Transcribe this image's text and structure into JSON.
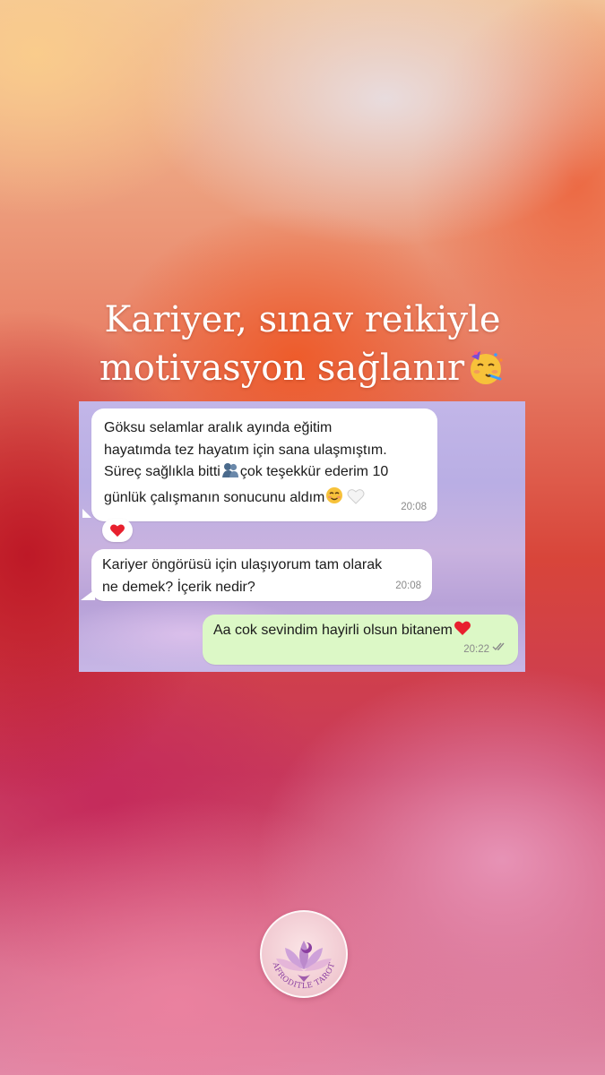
{
  "headline": {
    "line1": "Kariyer, sınav reikiyle",
    "line2": "motivasyon sağlanır",
    "emoji": "partying-face-icon"
  },
  "chat": {
    "messages": [
      {
        "direction": "incoming",
        "lines": [
          "Göksu selamlar aralık ayında eğitim",
          "hayatımda tez hayatım için sana ulaşmıştım.",
          "Süreç sağlıkla bitti",
          "çok teşekkür ederim 10",
          "günlük çalışmanın sonucunu aldım"
        ],
        "time": "20:08",
        "emojis": [
          "people-hugging-icon",
          "smiling-face-icon",
          "white-heart-icon"
        ],
        "reaction": "red-heart-icon"
      },
      {
        "direction": "incoming",
        "lines": [
          "Kariyer öngörüsü için ulaşıyorum tam olarak",
          "ne demek? İçerik nedir?"
        ],
        "time": "20:08"
      },
      {
        "direction": "outgoing",
        "lines": [
          "Aa cok sevindim hayirli olsun bitanem"
        ],
        "time": "20:22",
        "emojis": [
          "red-heart-icon"
        ],
        "status": "read-double-check-icon"
      }
    ]
  },
  "logo": {
    "text": "AFRODITLE TAROT",
    "icon": "lotus-moon-icon"
  },
  "colors": {
    "incoming_bubble": "#ffffff",
    "outgoing_bubble": "#dcf8c6",
    "timestamp": "#8a8a8a",
    "read_ticks": "#8a8a8a",
    "logo_accent": "#8b3fa0"
  }
}
